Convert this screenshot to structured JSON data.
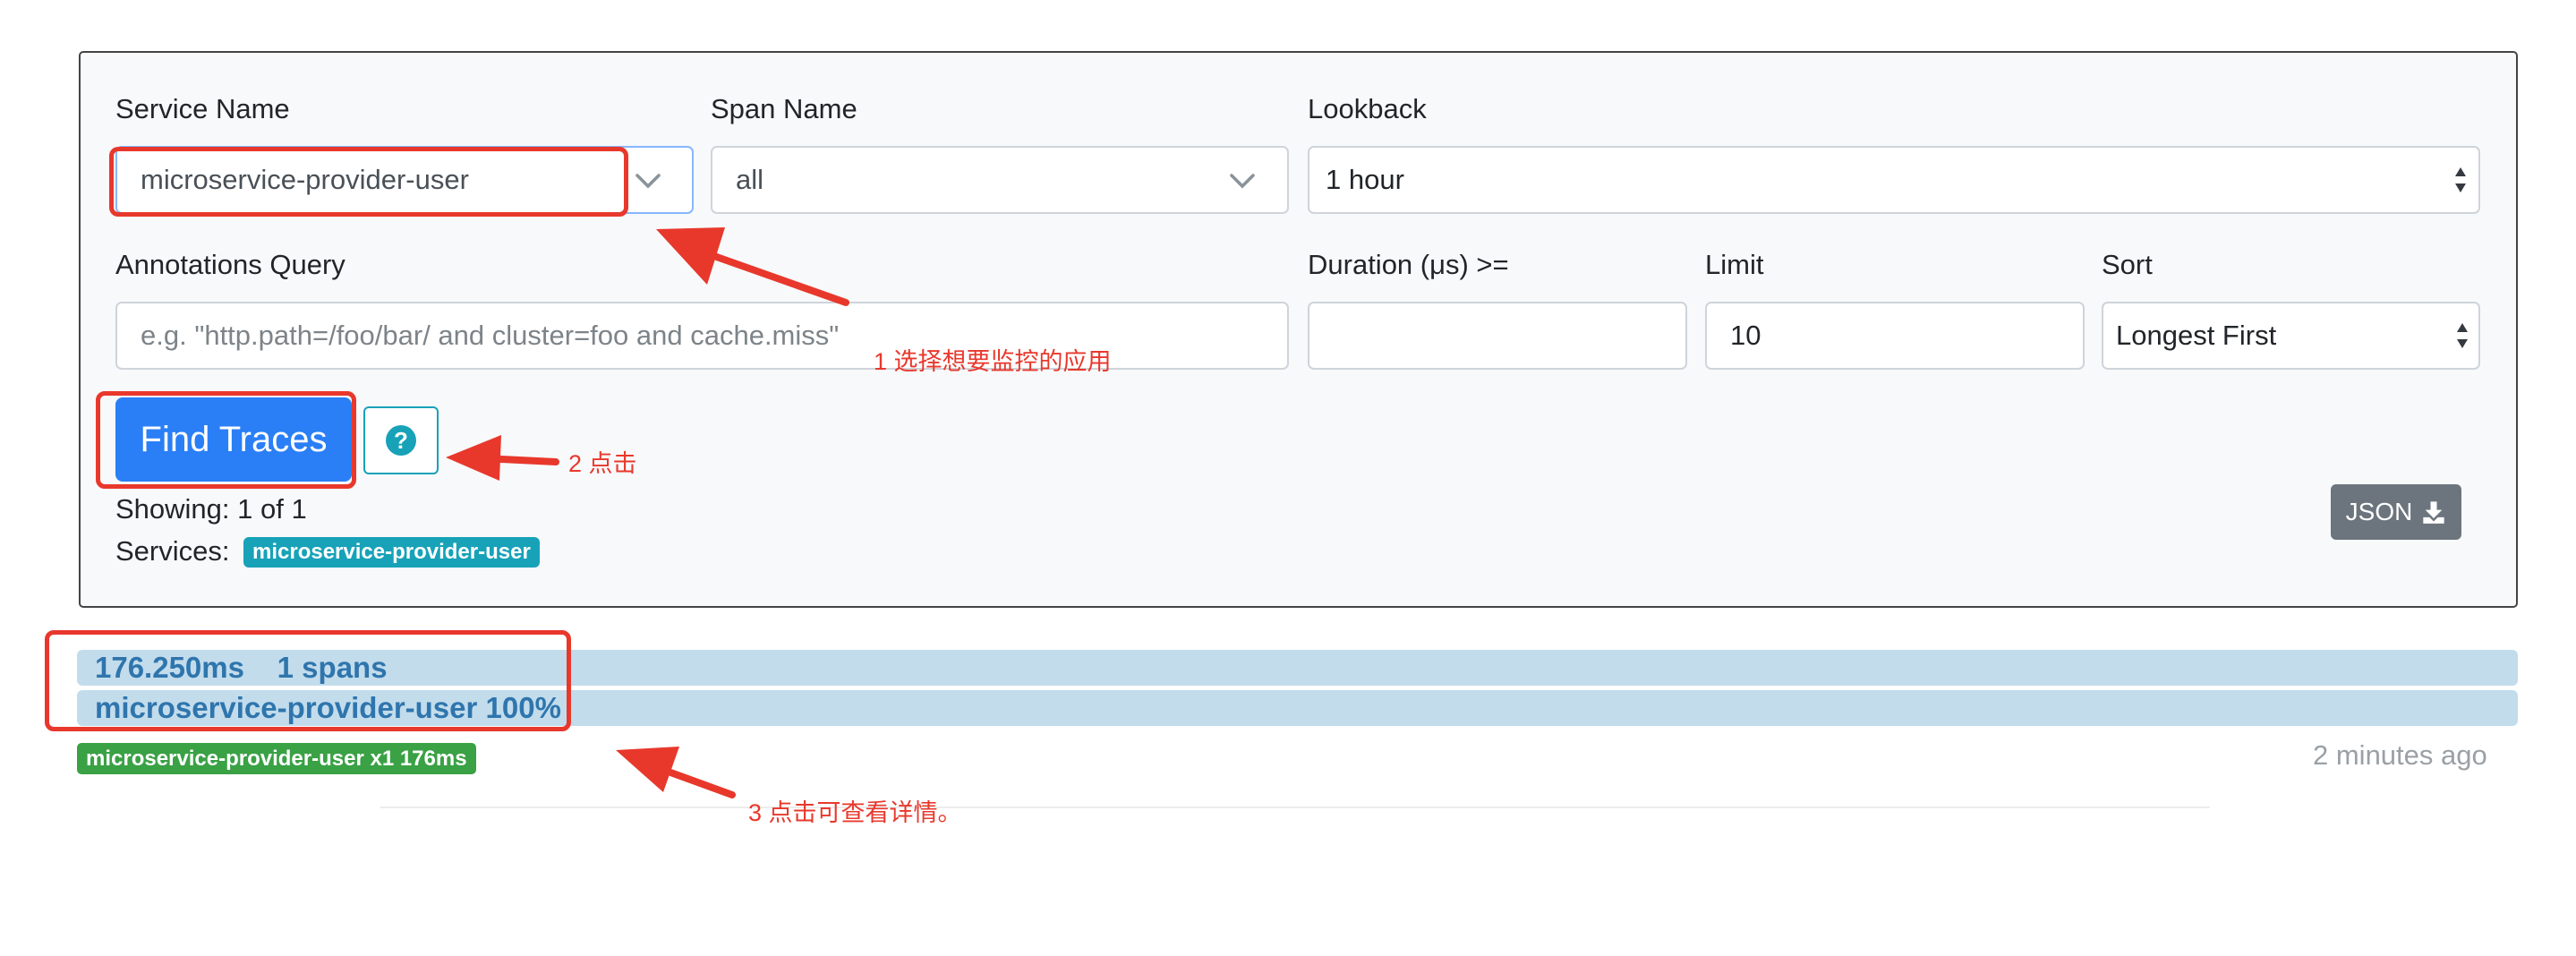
{
  "form": {
    "service_name_label": "Service Name",
    "service_name_value": "microservice-provider-user",
    "span_name_label": "Span Name",
    "span_name_value": "all",
    "lookback_label": "Lookback",
    "lookback_value": "1 hour",
    "annotations_label": "Annotations Query",
    "annotations_placeholder": "e.g. \"http.path=/foo/bar/ and cluster=foo and cache.miss\"",
    "duration_label": "Duration (μs) >=",
    "duration_value": "",
    "limit_label": "Limit",
    "limit_value": "10",
    "sort_label": "Sort",
    "sort_value": "Longest First"
  },
  "actions": {
    "find_traces_label": "Find Traces",
    "help_icon": "question-circle-icon",
    "json_label": "JSON",
    "json_icon": "download-icon"
  },
  "summary": {
    "showing": "Showing: 1 of 1",
    "services_label": "Services:",
    "service_badge": "microservice-provider-user"
  },
  "trace": {
    "duration_and_spans": "176.250ms    1 spans",
    "service_percentage": "microservice-provider-user 100%",
    "service_badge": "microservice-provider-user x1 176ms",
    "time_ago": "2 minutes ago"
  },
  "annotations": {
    "step1": "1 选择想要监控的应用",
    "step2": "2 点击",
    "step3": "3 点击可查看详情。"
  },
  "colors": {
    "primary": "#2a7ff6",
    "info": "#17a2b8",
    "success": "#3aa145",
    "annotation_red": "#e8382c",
    "trace_bar": "#c2dcec"
  }
}
